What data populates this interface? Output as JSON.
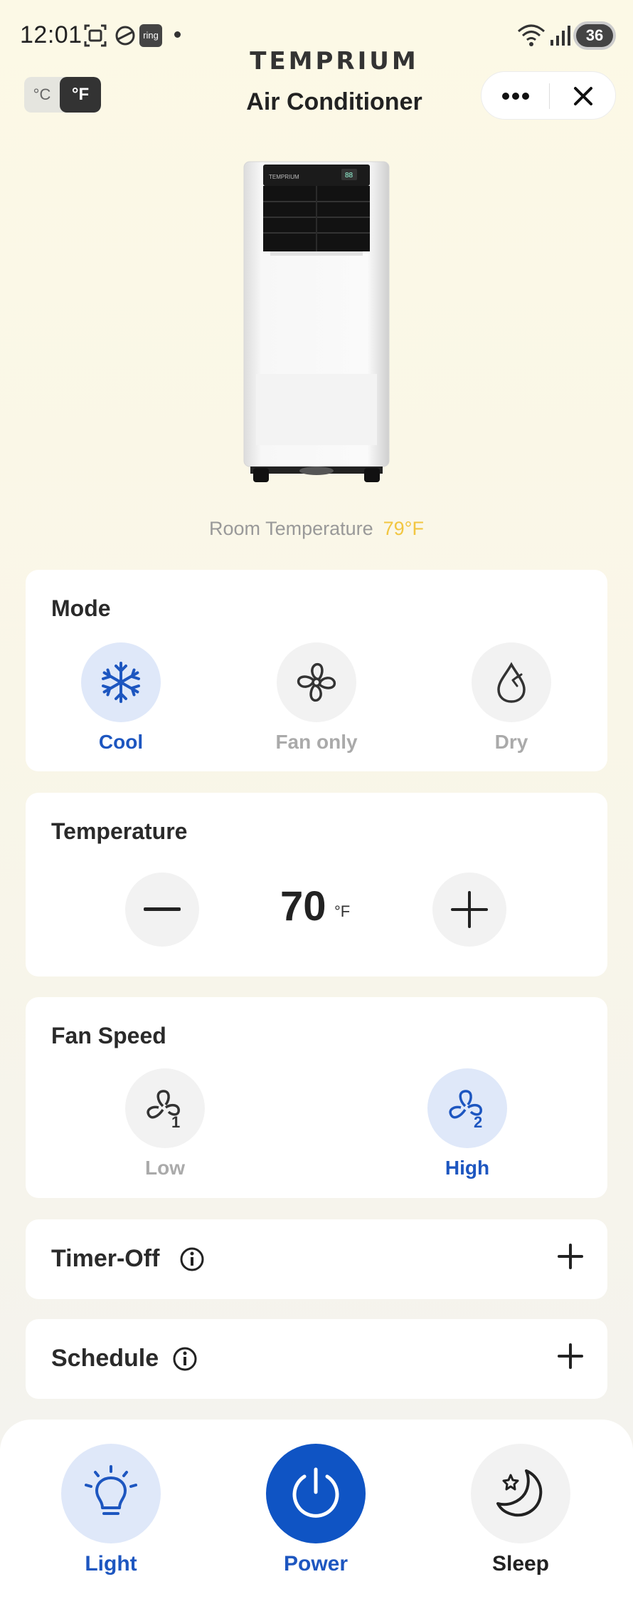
{
  "status_bar": {
    "time": "12:01",
    "ring_label": "ring",
    "battery": "36"
  },
  "header": {
    "unit_c": "°C",
    "unit_f": "°F",
    "brand": "TEMPRIUM",
    "title": "Air Conditioner"
  },
  "room": {
    "label": "Room Temperature",
    "value": "79°F"
  },
  "device_image": {
    "brand": "TEMPRIUM",
    "display": "88"
  },
  "mode": {
    "title": "Mode",
    "options": [
      {
        "label": "Cool",
        "icon": "snowflake-icon",
        "active": true
      },
      {
        "label": "Fan only",
        "icon": "fan-icon",
        "active": false
      },
      {
        "label": "Dry",
        "icon": "droplet-icon",
        "active": false
      }
    ]
  },
  "temperature": {
    "title": "Temperature",
    "value": "70",
    "unit": "°F"
  },
  "fan_speed": {
    "title": "Fan Speed",
    "options": [
      {
        "label": "Low",
        "icon": "fan-speed-1-icon",
        "active": false
      },
      {
        "label": "High",
        "icon": "fan-speed-2-icon",
        "active": true
      }
    ]
  },
  "timer_off": {
    "title": "Timer-Off"
  },
  "schedule": {
    "title": "Schedule"
  },
  "bottom": {
    "light": "Light",
    "power": "Power",
    "sleep": "Sleep"
  },
  "colors": {
    "accent": "#1d56c0",
    "power": "#0f54c4",
    "room_temp": "#f2c640",
    "active_bg": "#dfe8f9"
  }
}
